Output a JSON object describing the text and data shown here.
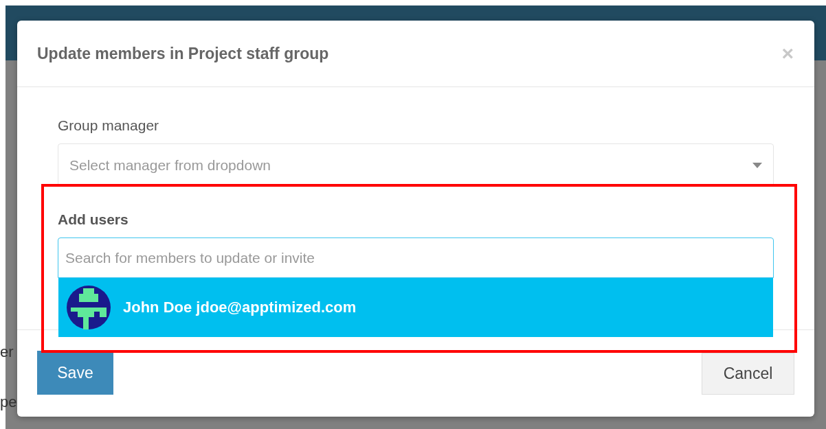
{
  "background": {
    "fragments": [
      "er",
      "pe"
    ]
  },
  "dialog": {
    "title": "Update members in Project staff group",
    "close": "×",
    "fields": [
      {
        "kind": "select",
        "label": "Group manager",
        "placeholder": "Select manager from dropdown"
      },
      {
        "kind": "search",
        "label": "Add users",
        "placeholder": "Search for members to update or invite",
        "results": [
          {
            "name": "John Doe jdoe@apptimized.com",
            "selected": true
          }
        ]
      }
    ],
    "buttons": [
      {
        "label": "Save",
        "kind": "primary"
      },
      {
        "label": "Cancel",
        "kind": "default"
      }
    ]
  },
  "annotation": {
    "kind": "highlight",
    "color": "#ff0000"
  }
}
